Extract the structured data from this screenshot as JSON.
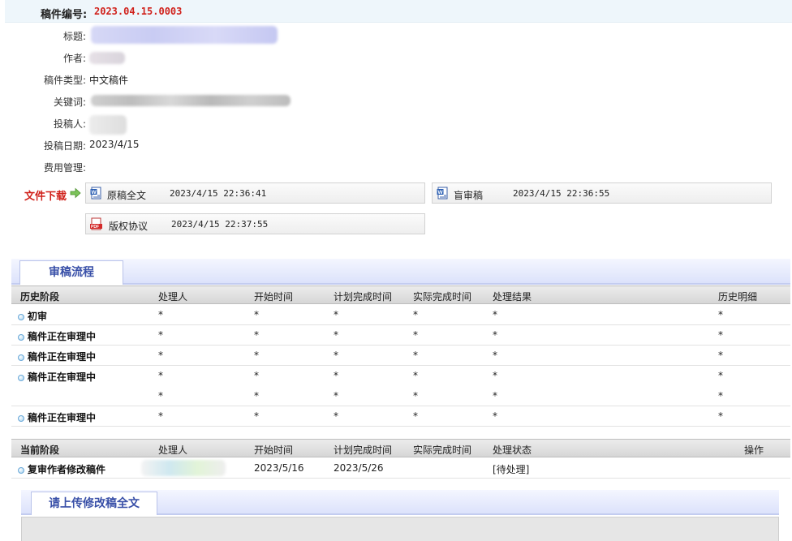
{
  "manuscript": {
    "number_label": "稿件编号:",
    "number_value": "2023.04.15.0003"
  },
  "info": {
    "title_label": "标题:",
    "author_label": "作者:",
    "type_label": "稿件类型:",
    "type_value": "中文稿件",
    "keywords_label": "关键词:",
    "submitter_label": "投稿人:",
    "date_label": "投稿日期:",
    "date_value": "2023/4/15",
    "fee_label": "费用管理:"
  },
  "downloads": {
    "title": "文件下载",
    "files": [
      {
        "name": "原稿全文",
        "time": "2023/4/15 22:36:41",
        "icon": "word-doc-icon"
      },
      {
        "name": "盲审稿",
        "time": "2023/4/15 22:36:55",
        "icon": "word-doc-icon"
      },
      {
        "name": "版权协议",
        "time": "2023/4/15 22:37:55",
        "icon": "pdf-icon"
      }
    ]
  },
  "review_flow": {
    "tab_label": "审稿流程",
    "history_headers": [
      "历史阶段",
      "处理人",
      "开始时间",
      "计划完成时间",
      "实际完成时间",
      "处理结果",
      "历史明细"
    ],
    "history_rows": [
      {
        "stage": "初审",
        "cells": [
          "*",
          "*",
          "*",
          "*",
          "*",
          "*"
        ]
      },
      {
        "stage": "稿件正在审理中",
        "cells": [
          "*",
          "*",
          "*",
          "*",
          "*",
          "*"
        ]
      },
      {
        "stage": "稿件正在审理中",
        "cells": [
          "*",
          "*",
          "*",
          "*",
          "*",
          "*"
        ]
      },
      {
        "stage": "稿件正在审理中",
        "cells": [
          "*",
          "*",
          "*",
          "*",
          "*",
          "*"
        ]
      },
      {
        "stage": "",
        "cells": [
          "*",
          "*",
          "*",
          "*",
          "*",
          "*"
        ]
      },
      {
        "stage": "稿件正在审理中",
        "cells": [
          "*",
          "*",
          "*",
          "*",
          "*",
          "*"
        ]
      }
    ],
    "current_headers": [
      "当前阶段",
      "处理人",
      "开始时间",
      "计划完成时间",
      "实际完成时间",
      "处理状态",
      "操作"
    ],
    "current_row": {
      "stage": "复审作者修改稿件",
      "start": "2023/5/16",
      "planned": "2023/5/26",
      "actual": "",
      "status": "[待处理]",
      "action": ""
    }
  },
  "upload": {
    "tab_label": "请上传修改稿全文"
  },
  "colors": {
    "accent_red": "#d0201a",
    "tab_blue": "#3950a8",
    "header_bg": "#eef6fb"
  }
}
